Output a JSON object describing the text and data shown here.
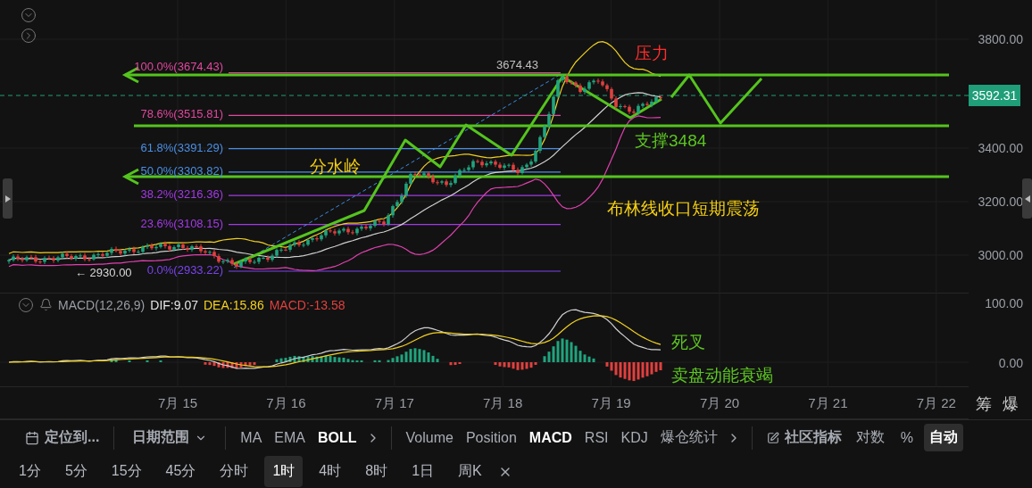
{
  "price_axis": {
    "ticks": [
      "3800.00",
      "3400.00",
      "3200.00",
      "3000.00"
    ],
    "current_price": "3592.31"
  },
  "fib_levels": [
    {
      "label": "100.0%(3674.43)",
      "color": "#e0489e"
    },
    {
      "label": "78.6%(3515.81)",
      "color": "#e0489e"
    },
    {
      "label": "61.8%(3391.29)",
      "color": "#4a8fe6"
    },
    {
      "label": "50.0%(3303.82)",
      "color": "#4a8fe6"
    },
    {
      "label": "38.2%(3216.36)",
      "color": "#a33ae6"
    },
    {
      "label": "23.6%(3108.15)",
      "color": "#a33ae6"
    },
    {
      "label": "0.0%(2933.22)",
      "color": "#7a44ee"
    }
  ],
  "markers": {
    "high": "3674.43",
    "low": "← 2930.00"
  },
  "annotations": [
    {
      "text": "压力",
      "color": "#ff2d2d"
    },
    {
      "text": "分水岭",
      "color": "#f5cf10"
    },
    {
      "text": "支撑3484",
      "color": "#5cc522"
    },
    {
      "text": "布林线收口短期震荡",
      "color": "#f5cf10"
    },
    {
      "text": "死叉",
      "color": "#5cc522"
    },
    {
      "text": "卖盘动能衰竭",
      "color": "#5cc522"
    }
  ],
  "macd": {
    "title": "MACD(12,26,9)",
    "dif": "DIF:9.07",
    "dea": "DEA:15.86",
    "value": "MACD:-13.58",
    "ticks": [
      "100.00",
      "0.00"
    ]
  },
  "dates": [
    "7月 15",
    "7月 16",
    "7月 17",
    "7月 18",
    "7月 19",
    "7月 20",
    "7月 21",
    "7月 22"
  ],
  "side_labels": [
    "筹",
    "爆"
  ],
  "toolbar": {
    "locate": "定位到...",
    "date_range": "日期范围",
    "indicators": [
      {
        "label": "MA",
        "selected": false
      },
      {
        "label": "EMA",
        "selected": false
      },
      {
        "label": "BOLL",
        "selected": true
      }
    ],
    "sub_indicators": [
      {
        "label": "Volume",
        "selected": false
      },
      {
        "label": "Position",
        "selected": false
      },
      {
        "label": "MACD",
        "selected": true
      },
      {
        "label": "RSI",
        "selected": false
      },
      {
        "label": "KDJ",
        "selected": false
      },
      {
        "label": "爆仓统计",
        "selected": false
      }
    ],
    "community": "社区指标",
    "scale_options": [
      {
        "label": "对数",
        "selected": false
      },
      {
        "label": "%",
        "selected": false
      },
      {
        "label": "自动",
        "selected": true
      }
    ]
  },
  "intervals": [
    {
      "label": "1分",
      "selected": false
    },
    {
      "label": "5分",
      "selected": false
    },
    {
      "label": "15分",
      "selected": false
    },
    {
      "label": "45分",
      "selected": false
    },
    {
      "label": "分时",
      "selected": false
    },
    {
      "label": "1时",
      "selected": true
    },
    {
      "label": "4时",
      "selected": false
    },
    {
      "label": "8时",
      "selected": false
    },
    {
      "label": "1日",
      "selected": false
    },
    {
      "label": "周K",
      "selected": false
    }
  ]
}
